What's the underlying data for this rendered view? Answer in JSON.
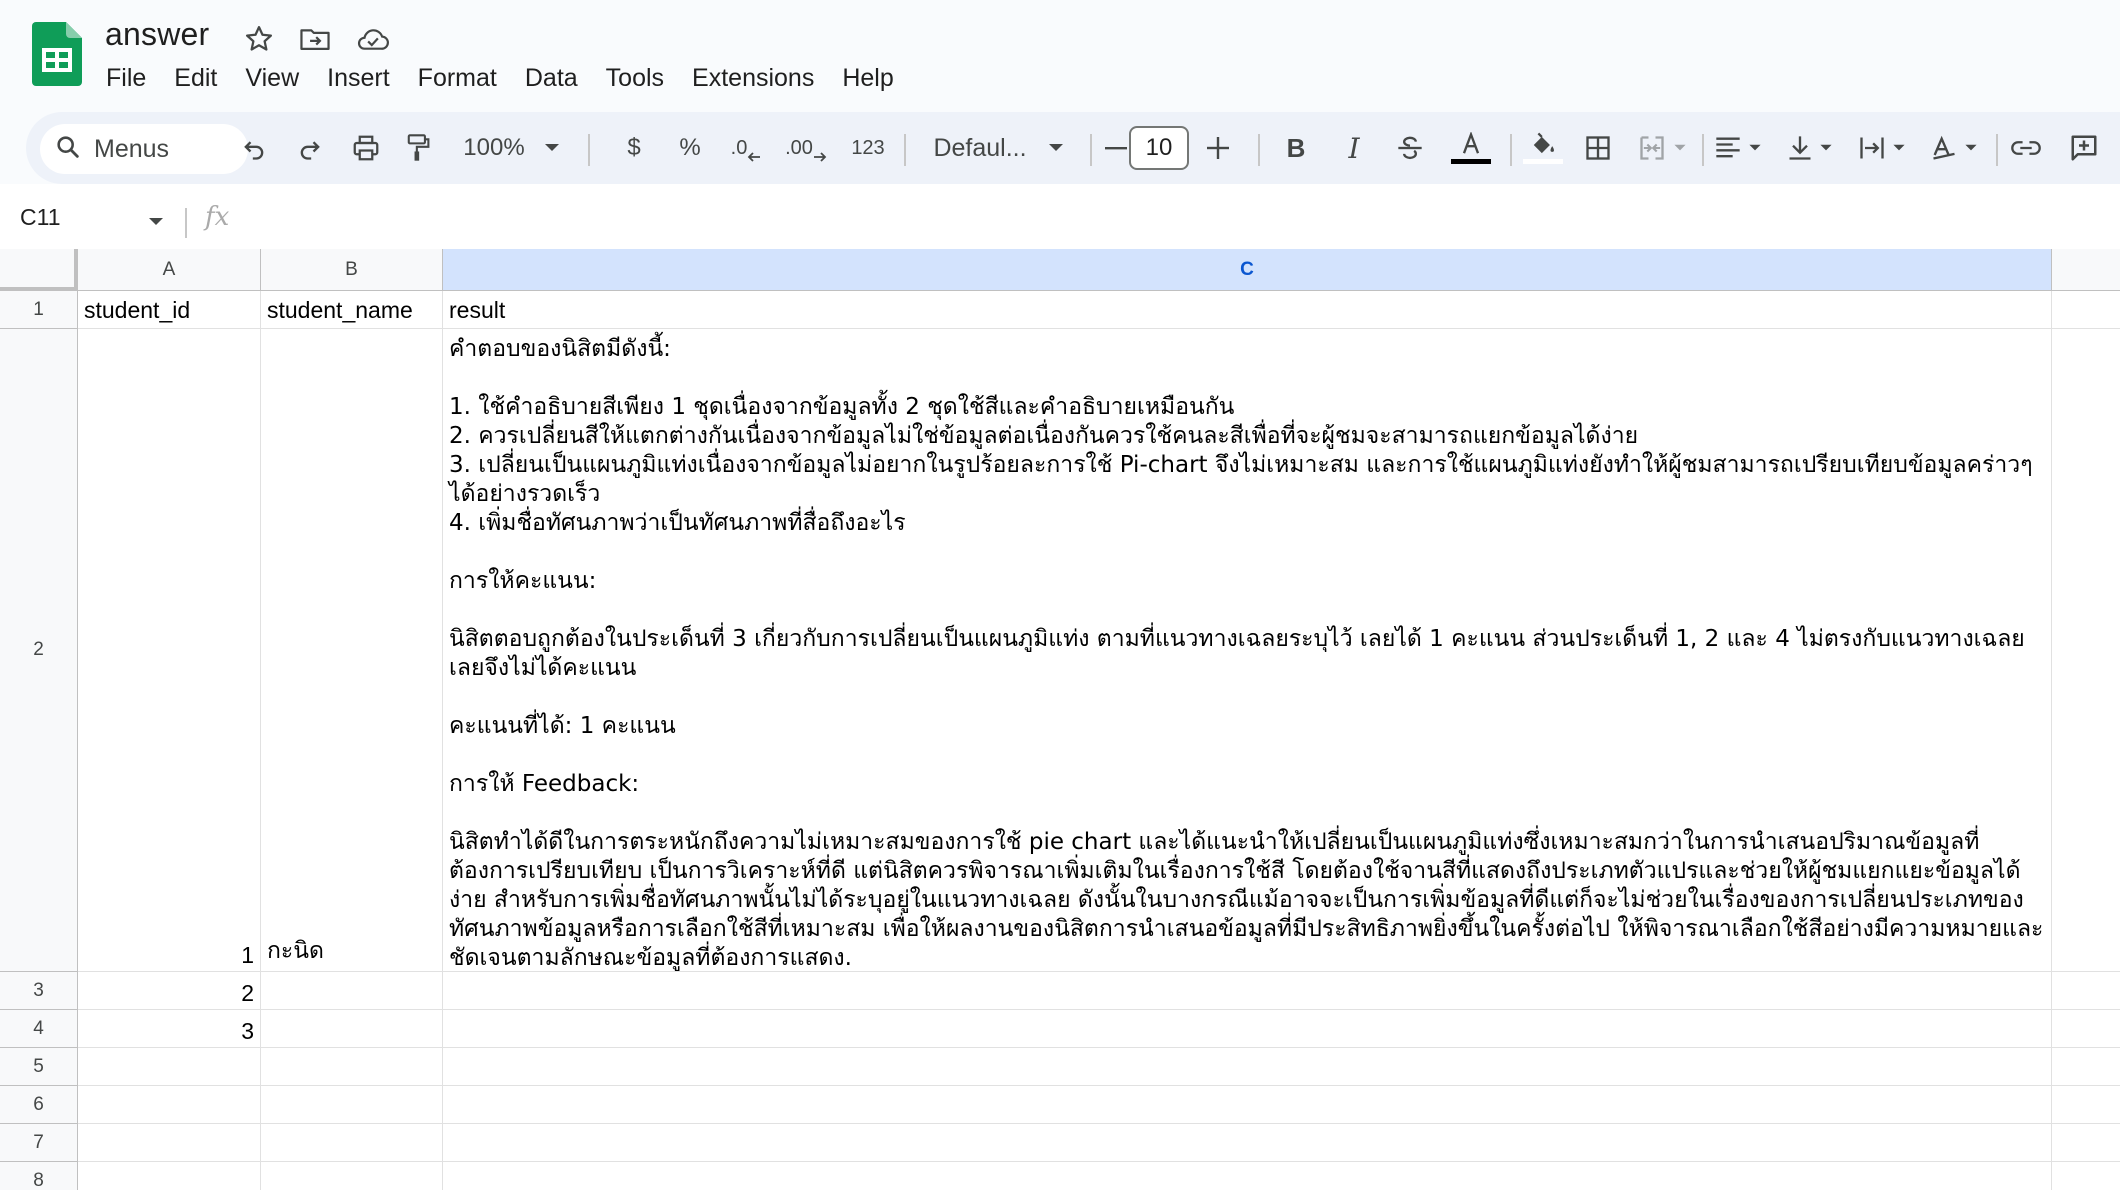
{
  "app": {
    "document_title": "answer",
    "accent_color": "#0f9d58"
  },
  "menubar": {
    "items": [
      "File",
      "Edit",
      "View",
      "Insert",
      "Format",
      "Data",
      "Tools",
      "Extensions",
      "Help"
    ]
  },
  "toolbar": {
    "search_label": "Menus",
    "zoom": "100%",
    "currency": "$",
    "percent": "%",
    "decrease_decimal": ".0",
    "increase_decimal": ".00",
    "number_format": "123",
    "font_family": "Defaul...",
    "font_size": "10",
    "bold": "B",
    "italic": "I"
  },
  "formula_bar": {
    "name_box": "C11",
    "fx": "fx"
  },
  "grid": {
    "columns": [
      "A",
      "B",
      "C"
    ],
    "selected_column": "C",
    "rows": [
      "1",
      "2",
      "3",
      "4",
      "5",
      "6",
      "7",
      "8"
    ],
    "cells": {
      "A1": "student_id",
      "B1": "student_name",
      "C1": "result",
      "A2": "1",
      "B2": "กะนิด",
      "C2": "คำตอบของนิสิตมีดังนี้:\n\n1. ใช้คำอธิบายสีเพียง 1 ชุดเนื่องจากข้อมูลทั้ง 2 ชุดใช้สีและคำอธิบายเหมือนกัน\n2. ควรเปลี่ยนสีให้แตกต่างกันเนื่องจากข้อมูลไม่ใช่ข้อมูลต่อเนื่องกันควรใช้คนละสีเพื่อที่จะผู้ชมจะสามารถแยกข้อมูลได้ง่าย\n3. เปลี่ยนเป็นแผนภูมิแท่งเนื่องจากข้อมูลไม่อยากในรูปร้อยละการใช้ Pi-chart จึงไม่เหมาะสม และการใช้แผนภูมิแท่งยังทำให้ผู้ชมสามารถเปรียบเทียบข้อมูลคร่าวๆได้อย่างรวดเร็ว\n4. เพิ่มชื่อทัศนภาพว่าเป็นทัศนภาพที่สื่อถึงอะไร\n\nการให้คะแนน:\n\nนิสิตตอบถูกต้องในประเด็นที่ 3 เกี่ยวกับการเปลี่ยนเป็นแผนภูมิแท่ง ตามที่แนวทางเฉลยระบุไว้ เลยได้ 1 คะแนน ส่วนประเด็นที่ 1, 2 และ 4 ไม่ตรงกับแนวทางเฉลยเลยจึงไม่ได้คะแนน\n\nคะแนนที่ได้: 1 คะแนน\n\nการให้ Feedback:\n\nนิสิตทำได้ดีในการตระหนักถึงความไม่เหมาะสมของการใช้ pie chart และได้แนะนำให้เปลี่ยนเป็นแผนภูมิแท่งซึ่งเหมาะสมกว่าในการนำเสนอปริมาณข้อมูลที่ต้องการเปรียบเทียบ เป็นการวิเคราะห์ที่ดี แต่นิสิตควรพิจารณาเพิ่มเติมในเรื่องการใช้สี โดยต้องใช้จานสีที่แสดงถึงประเภทตัวแปรและช่วยให้ผู้ชมแยกแยะข้อมูลได้ง่าย สำหรับการเพิ่มชื่อทัศนภาพนั้นไม่ได้ระบุอยู่ในแนวทางเฉลย ดังนั้นในบางกรณีแม้อาจจะเป็นการเพิ่มข้อมูลที่ดีแต่ก็จะไม่ช่วยในเรื่องของการเปลี่ยนประเภทของทัศนภาพข้อมูลหรือการเลือกใช้สีที่เหมาะสม เพื่อให้ผลงานของนิสิตการนำเสนอข้อมูลที่มีประสิทธิภาพยิ่งขึ้นในครั้งต่อไป ให้พิจารณาเลือกใช้สีอย่างมีความหมายและชัดเจนตามลักษณะข้อมูลที่ต้องการแสดง.",
      "A3": "2",
      "A4": "3"
    }
  }
}
